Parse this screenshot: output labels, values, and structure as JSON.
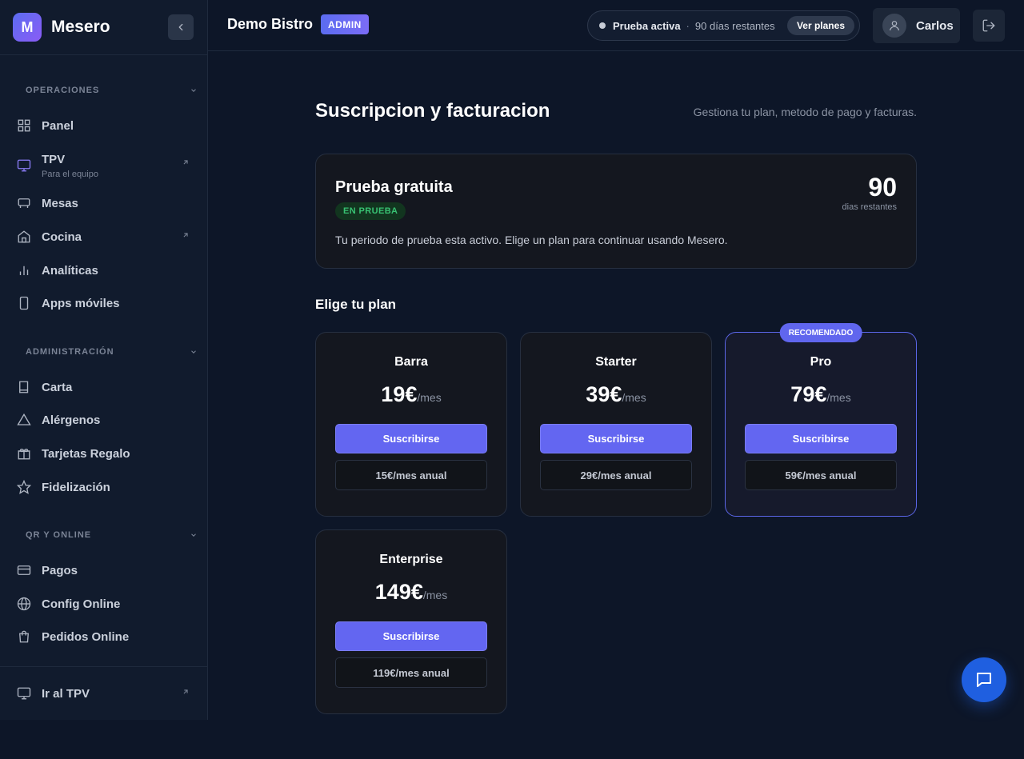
{
  "brand": {
    "logo_letter": "M",
    "name": "Mesero"
  },
  "sidebar": {
    "sections": [
      {
        "label": "OPERACIONES"
      },
      {
        "label": "ADMINISTRACIÓN"
      },
      {
        "label": "QR Y ONLINE"
      }
    ],
    "items": [
      {
        "label": "Panel",
        "icon": "grid-icon"
      },
      {
        "label": "TPV",
        "sublabel": "Para el equipo",
        "icon": "monitor-icon"
      },
      {
        "label": "Mesas",
        "icon": "table-icon"
      },
      {
        "label": "Cocina",
        "icon": "home-icon"
      },
      {
        "label": "Analíticas",
        "icon": "bar-chart-icon"
      },
      {
        "label": "Apps móviles",
        "icon": "smartphone-icon"
      },
      {
        "label": "Carta",
        "icon": "book-icon"
      },
      {
        "label": "Alérgenos",
        "icon": "warning-icon"
      },
      {
        "label": "Tarjetas Regalo",
        "icon": "gift-icon"
      },
      {
        "label": "Fidelización",
        "icon": "star-icon"
      },
      {
        "label": "Pagos",
        "icon": "credit-card-icon"
      },
      {
        "label": "Config Online",
        "icon": "globe-icon"
      },
      {
        "label": "Pedidos Online",
        "icon": "shopping-bag-icon"
      }
    ],
    "bottom_item": {
      "label": "Ir al TPV",
      "icon": "monitor-icon"
    }
  },
  "header": {
    "restaurant": "Demo Bistro",
    "role_badge": "ADMIN",
    "trial_status": "Prueba activa",
    "trial_separator": "·",
    "trial_days": "90 días restantes",
    "plans_button": "Ver planes",
    "user_name": "Carlos"
  },
  "main": {
    "title": "Suscripcion y facturacion",
    "subtitle": "Gestiona tu plan, metodo de pago y facturas.",
    "trial_card": {
      "title": "Prueba gratuita",
      "badge": "EN PRUEBA",
      "description": "Tu periodo de prueba esta activo. Elige un plan para continuar usando Mesero.",
      "days_value": "90",
      "days_label": "dias restantes"
    },
    "plans_heading": "Elige tu plan",
    "plans": [
      {
        "name": "Barra",
        "price": "19€",
        "unit": "/mes",
        "subscribe": "Suscribirse",
        "annual": "15€/mes anual"
      },
      {
        "name": "Starter",
        "price": "39€",
        "unit": "/mes",
        "subscribe": "Suscribirse",
        "annual": "29€/mes anual"
      },
      {
        "name": "Pro",
        "price": "79€",
        "unit": "/mes",
        "subscribe": "Suscribirse",
        "annual": "59€/mes anual",
        "badge": "RECOMENDADO"
      },
      {
        "name": "Enterprise",
        "price": "149€",
        "unit": "/mes",
        "subscribe": "Suscribirse",
        "annual": "119€/mes anual"
      }
    ]
  },
  "colors": {
    "accent": "#6366f1",
    "success": "#38c172",
    "background": "#0d1628",
    "fab": "#1f5fe0"
  }
}
